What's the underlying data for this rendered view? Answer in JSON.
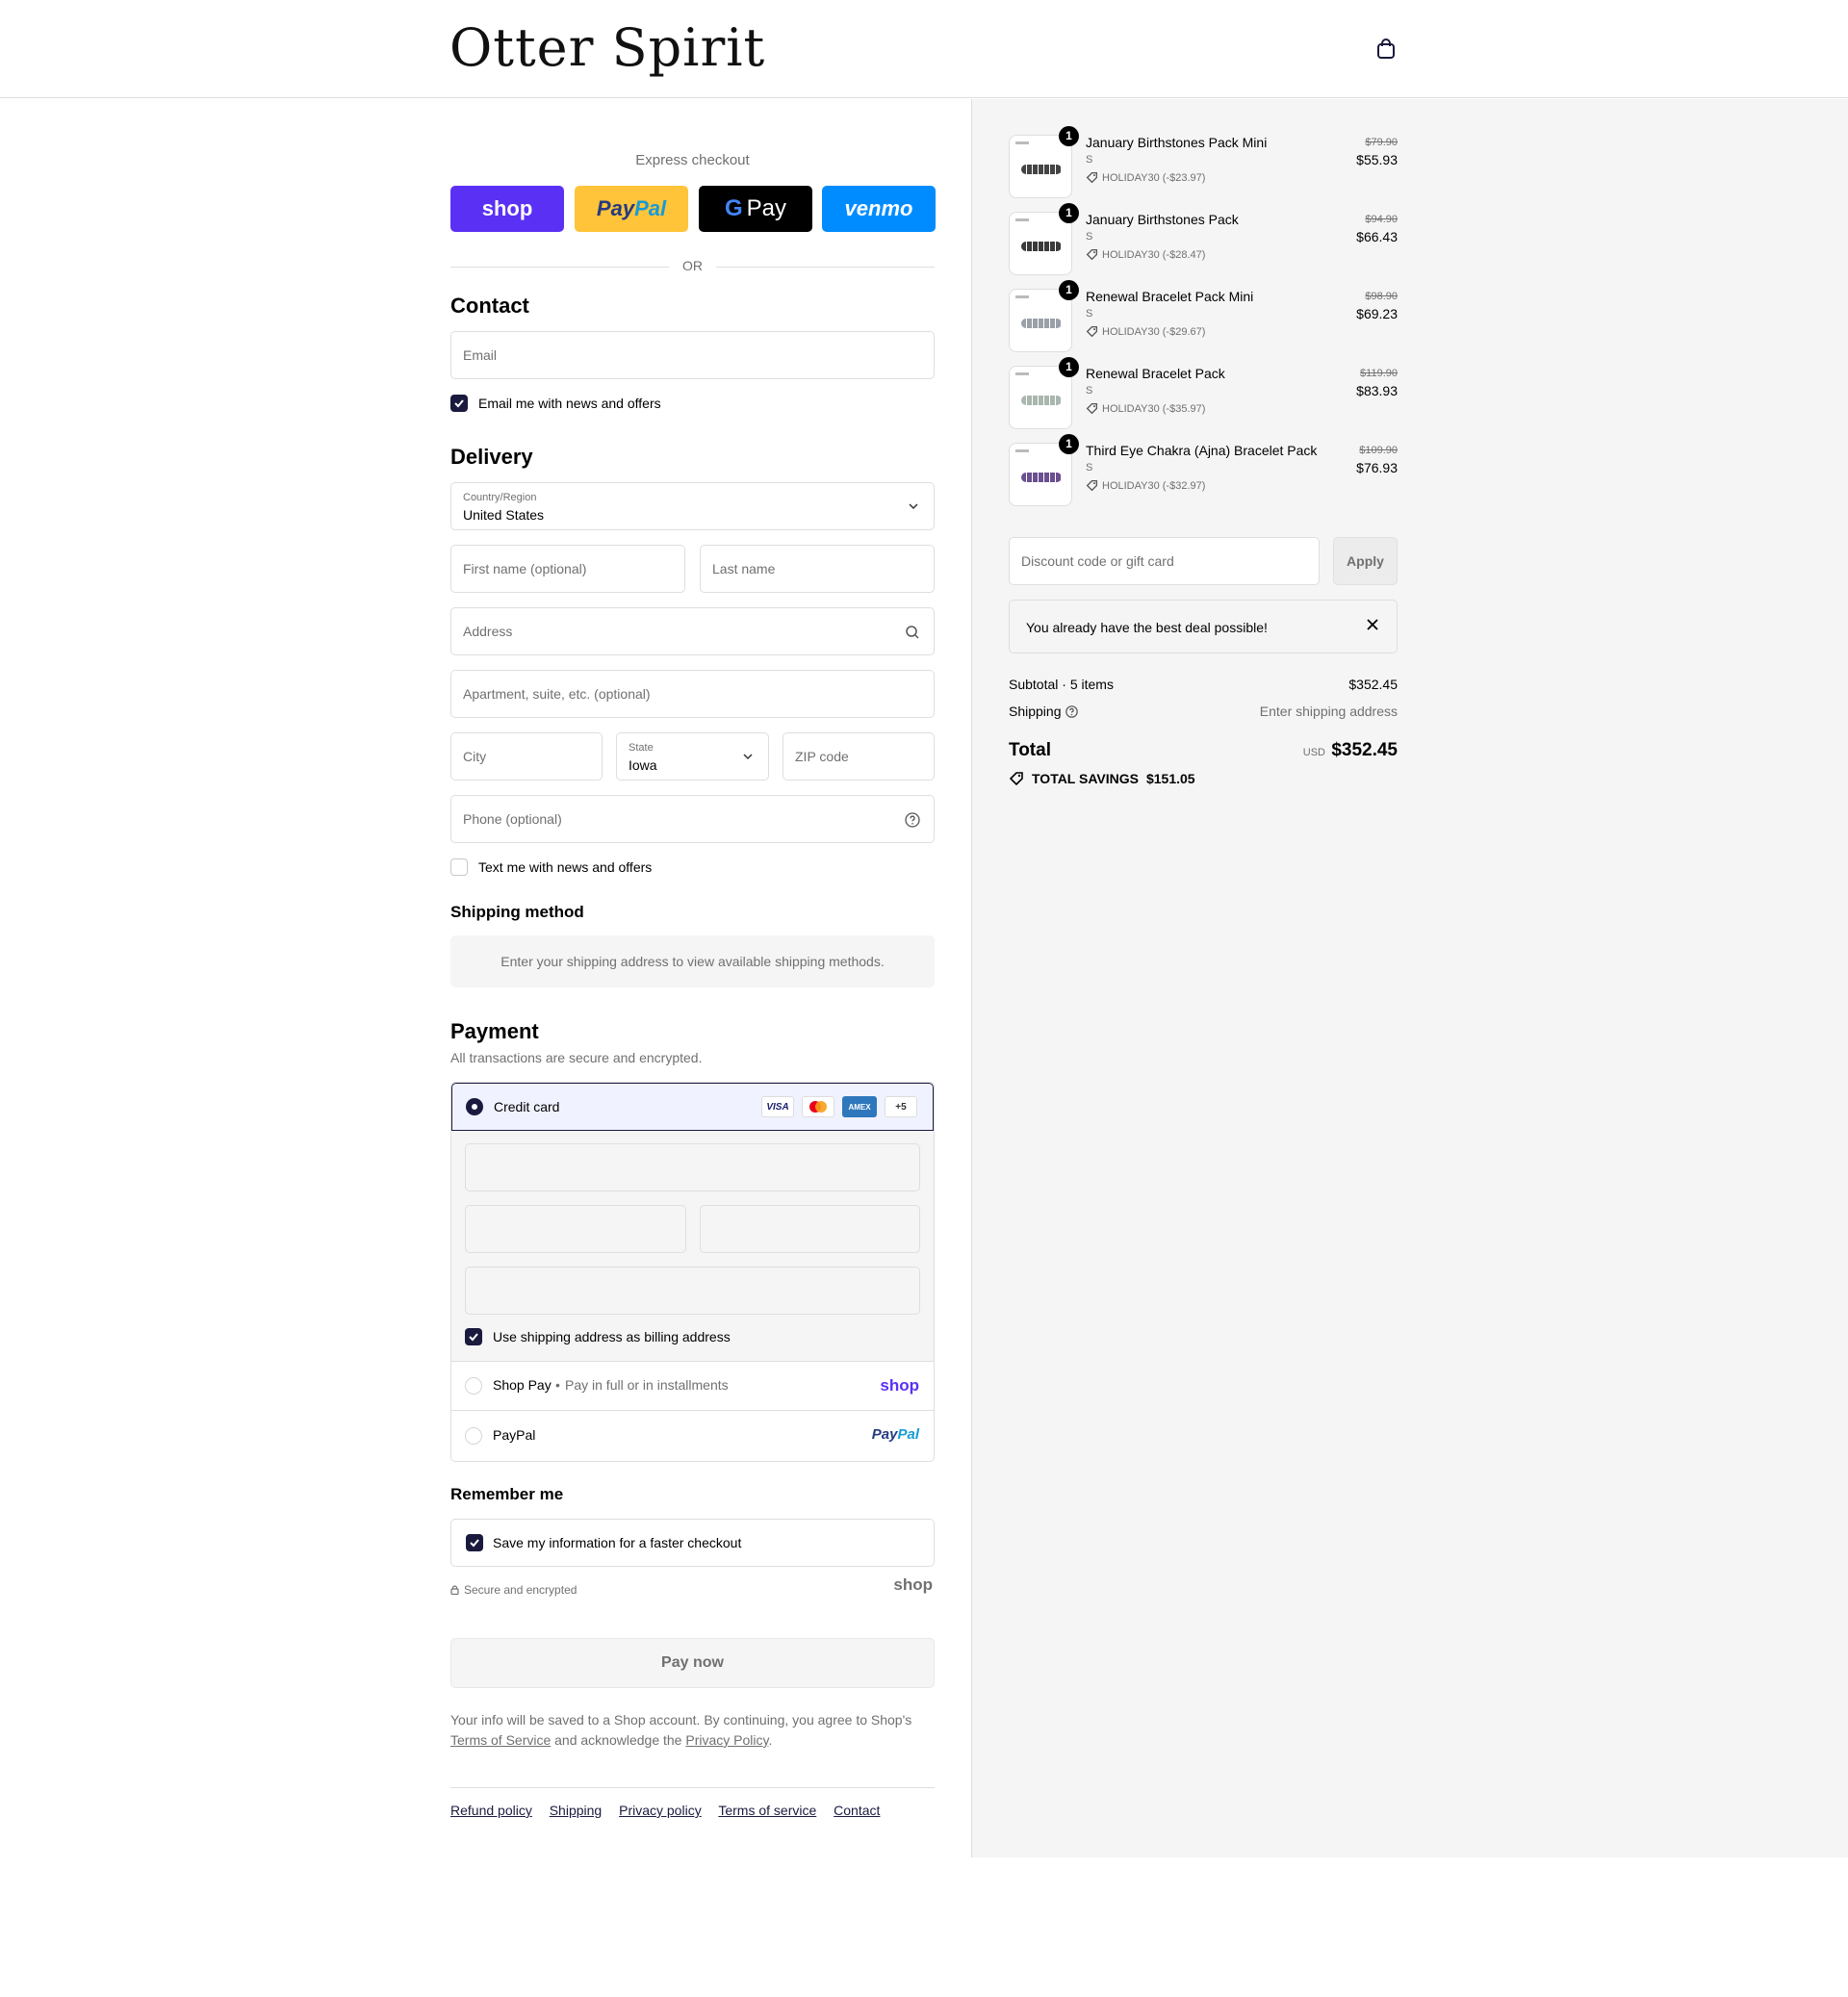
{
  "header": {
    "logo": "Otter Spirit",
    "cart_icon": "shopping-bag-icon"
  },
  "express": {
    "title": "Express checkout",
    "shop": "shop",
    "paypal_a": "Pay",
    "paypal_b": "Pal",
    "gpay_g": "G",
    "gpay_text": "Pay",
    "venmo": "venmo",
    "or": "OR"
  },
  "contact": {
    "heading": "Contact",
    "email_placeholder": "Email",
    "news_label": "Email me with news and offers"
  },
  "delivery": {
    "heading": "Delivery",
    "country_label": "Country/Region",
    "country_value": "United States",
    "first_name": "First name (optional)",
    "last_name": "Last name",
    "address": "Address",
    "apartment": "Apartment, suite, etc. (optional)",
    "city": "City",
    "state_label": "State",
    "state_value": "Iowa",
    "zip": "ZIP code",
    "phone": "Phone (optional)",
    "text_label": "Text me with news and offers"
  },
  "shipping_method": {
    "heading": "Shipping method",
    "message": "Enter your shipping address to view available shipping methods."
  },
  "payment": {
    "heading": "Payment",
    "subtitle": "All transactions are secure and encrypted.",
    "credit_card": "Credit card",
    "cards": [
      "VISA",
      "AMEX",
      "+5"
    ],
    "billing_label": "Use shipping address as billing address",
    "shop_pay": "Shop Pay",
    "shop_pay_sub": "Pay in full or in installments",
    "shop_logo": "shop",
    "paypal": "PayPal",
    "paypal_logo_a": "Pay",
    "paypal_logo_b": "Pal"
  },
  "remember": {
    "heading": "Remember me",
    "save_label": "Save my information for a faster checkout",
    "secure": "Secure and encrypted",
    "shop_logo": "shop"
  },
  "pay_now": "Pay now",
  "legal": {
    "line1": "Your info will be saved to a Shop account. By continuing, you agree to Shop's",
    "terms": "Terms of Service",
    "middle": "and acknowledge the",
    "privacy": "Privacy Policy",
    "end": "."
  },
  "footer": [
    "Refund policy",
    "Shipping",
    "Privacy policy",
    "Terms of service",
    "Contact"
  ],
  "summary": {
    "items": [
      {
        "qty": "1",
        "name": "January Birthstones Pack Mini",
        "variant": "S",
        "discount": "HOLIDAY30 (-$23.97)",
        "original": "$79.90",
        "price": "$55.93",
        "bead_color": "#444444"
      },
      {
        "qty": "1",
        "name": "January Birthstones Pack",
        "variant": "S",
        "discount": "HOLIDAY30 (-$28.47)",
        "original": "$94.90",
        "price": "$66.43",
        "bead_color": "#3a3a3a"
      },
      {
        "qty": "1",
        "name": "Renewal Bracelet Pack Mini",
        "variant": "S",
        "discount": "HOLIDAY30 (-$29.67)",
        "original": "$98.90",
        "price": "$69.23",
        "bead_color": "#9aa0a8"
      },
      {
        "qty": "1",
        "name": "Renewal Bracelet Pack",
        "variant": "S",
        "discount": "HOLIDAY30 (-$35.97)",
        "original": "$119.90",
        "price": "$83.93",
        "bead_color": "#a9b7ae"
      },
      {
        "qty": "1",
        "name": "Third Eye Chakra (Ajna) Bracelet Pack",
        "variant": "S",
        "discount": "HOLIDAY30 (-$32.97)",
        "original": "$109.90",
        "price": "$76.93",
        "bead_color": "#6b4f8e"
      }
    ],
    "discount_placeholder": "Discount code or gift card",
    "apply": "Apply",
    "notice": "You already have the best deal possible!",
    "subtotal_label": "Subtotal · 5 items",
    "subtotal_value": "$352.45",
    "shipping_label": "Shipping",
    "shipping_value": "Enter shipping address",
    "total_label": "Total",
    "currency": "USD",
    "total_value": "$352.45",
    "savings_label": "TOTAL SAVINGS",
    "savings_value": "$151.05"
  },
  "colors": {
    "accent": "#1a1a3e",
    "shop_purple": "#5a31f4",
    "paypal_yellow": "#ffc439",
    "venmo_blue": "#008cff",
    "summary_bg": "#f5f5f5"
  }
}
